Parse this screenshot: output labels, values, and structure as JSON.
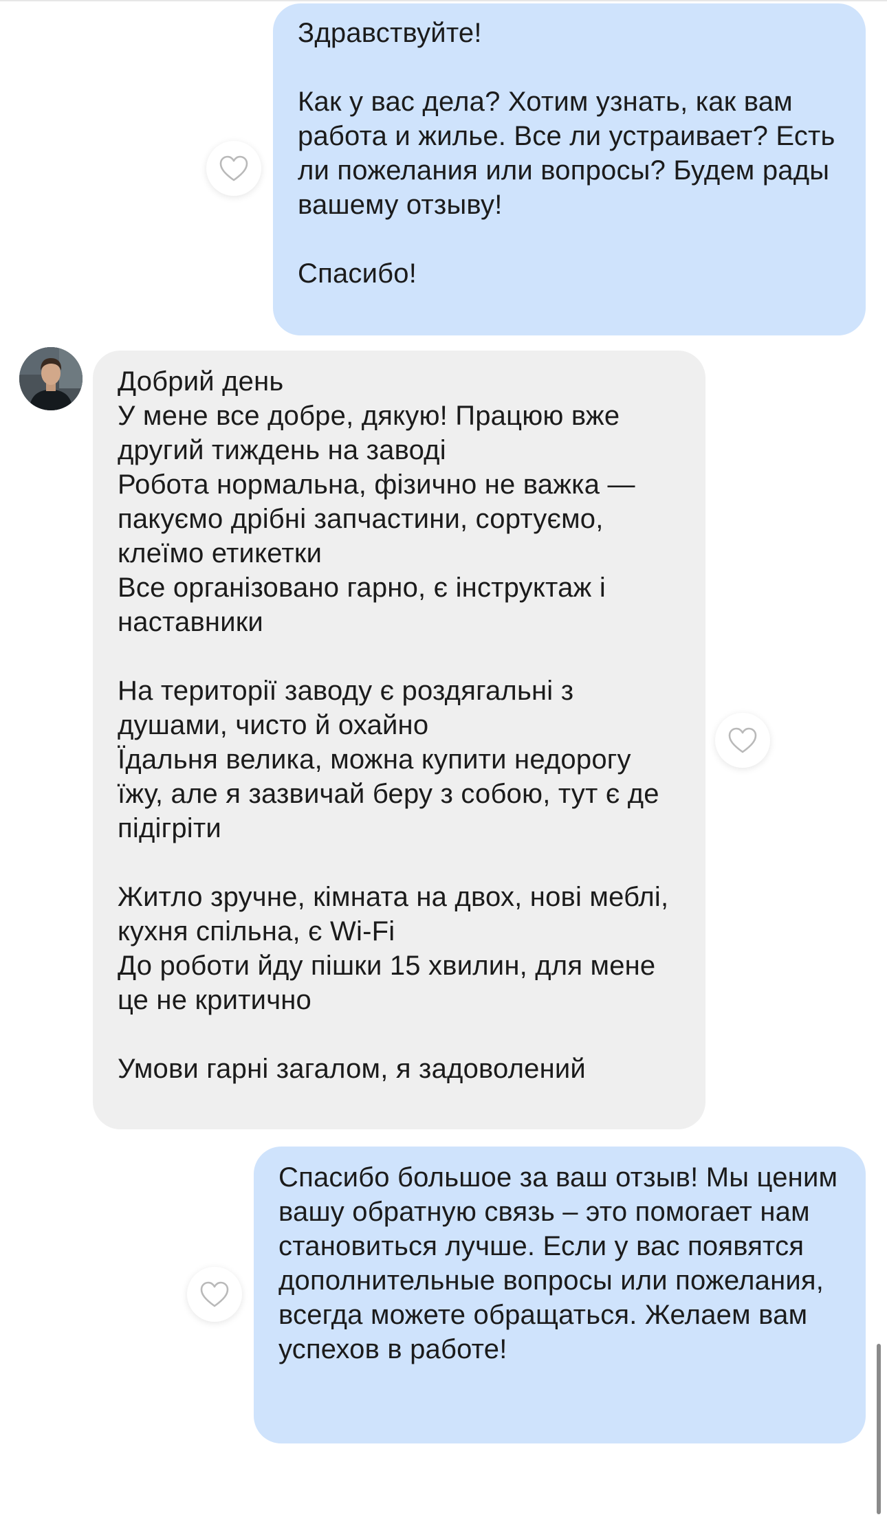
{
  "messages": [
    {
      "id": "msg-1",
      "direction": "outgoing",
      "text": "Здравствуйте!\n\nКак у вас дела? Хотим узнать, как вам работа и жилье. Все ли устраивает? Есть ли пожелания или вопросы? Будем рады вашему отзыву!\n\nСпасибо!"
    },
    {
      "id": "msg-2",
      "direction": "incoming",
      "text": "Добрий день\nУ мене все добре, дякую! Працюю вже другий тиждень на заводі\nРобота нормальна, фізично не важка — пакуємо дрібні запчастини, сортуємо, клеїмо етикетки\nВсе організовано гарно, є інструктаж і наставники\n\nНа території заводу є роздягальні з душами, чисто й охайно\nЇдальня велика, можна купити недорогу їжу, але я зазвичай беру з собою, тут є де підігріти\n\nЖитло зручне, кімната на двох, нові меблі, кухня спільна, є Wi-Fi\nДо роботи йду пішки 15 хвилин, для мене це не критично\n\nУмови гарні загалом, я задоволений"
    },
    {
      "id": "msg-3",
      "direction": "outgoing",
      "text": "Спасибо большое за ваш отзыв! Мы ценим вашу обратную связь – это помогает нам становиться лучше. Если у вас появятся дополнительные вопросы или пожелания, всегда можете обращаться. Желаем вам успехов в работе!"
    }
  ],
  "icons": {
    "like": "heart-outline-icon",
    "avatar": "user-avatar"
  },
  "colors": {
    "outgoing_bubble": "#cfe3fc",
    "incoming_bubble": "#efefef",
    "heart_stroke": "#b9b9b9"
  }
}
